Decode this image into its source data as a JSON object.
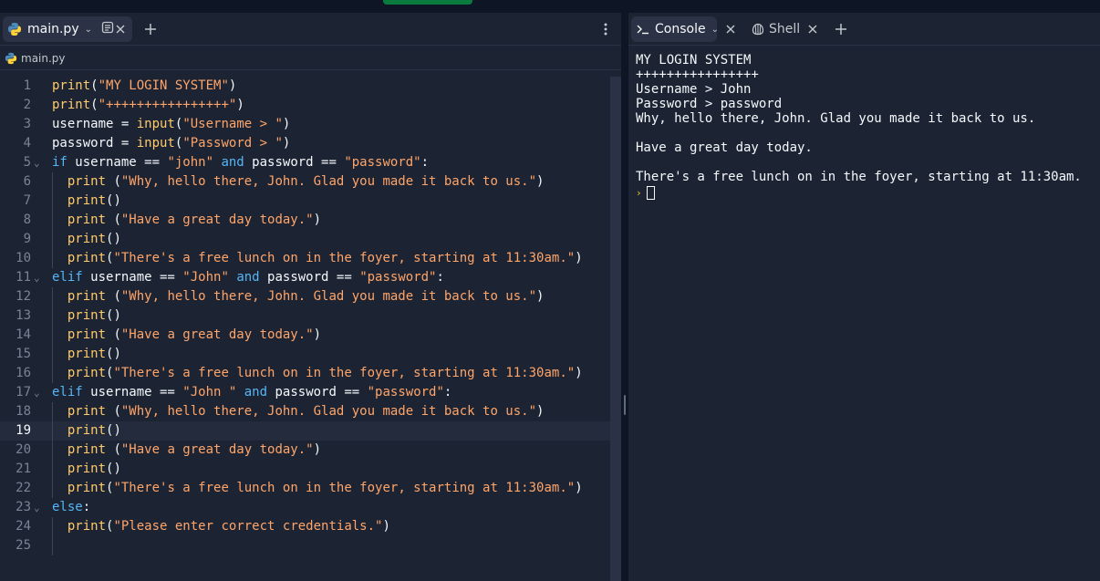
{
  "editor": {
    "tab_label": "main.py",
    "breadcrumb": "main.py",
    "current_line": 19,
    "lines": [
      {
        "n": "1",
        "fold": false,
        "tokens": [
          [
            "fn",
            "print"
          ],
          [
            "pl",
            "("
          ],
          [
            "st",
            "\"MY LOGIN SYSTEM\""
          ],
          [
            "pl",
            ")"
          ]
        ]
      },
      {
        "n": "2",
        "fold": false,
        "tokens": [
          [
            "fn",
            "print"
          ],
          [
            "pl",
            "("
          ],
          [
            "st",
            "\"++++++++++++++++\""
          ],
          [
            "pl",
            ")"
          ]
        ]
      },
      {
        "n": "3",
        "fold": false,
        "tokens": [
          [
            "pl",
            "username = "
          ],
          [
            "fn",
            "input"
          ],
          [
            "pl",
            "("
          ],
          [
            "st",
            "\"Username > \""
          ],
          [
            "pl",
            ")"
          ]
        ]
      },
      {
        "n": "4",
        "fold": false,
        "tokens": [
          [
            "pl",
            "password = "
          ],
          [
            "fn",
            "input"
          ],
          [
            "pl",
            "("
          ],
          [
            "st",
            "\"Password > \""
          ],
          [
            "pl",
            ")"
          ]
        ]
      },
      {
        "n": "5",
        "fold": true,
        "tokens": [
          [
            "kw",
            "if"
          ],
          [
            "pl",
            " username == "
          ],
          [
            "st",
            "\"john\""
          ],
          [
            "pl",
            " "
          ],
          [
            "kw",
            "and"
          ],
          [
            "pl",
            " password == "
          ],
          [
            "st",
            "\"password\""
          ],
          [
            "pl",
            ":"
          ]
        ]
      },
      {
        "n": "6",
        "fold": false,
        "tokens": [
          [
            "pl",
            "  "
          ],
          [
            "fn",
            "print"
          ],
          [
            "pl",
            " ("
          ],
          [
            "st",
            "\"Why, hello there, John. Glad you made it back to us.\""
          ],
          [
            "pl",
            ")"
          ]
        ]
      },
      {
        "n": "7",
        "fold": false,
        "tokens": [
          [
            "pl",
            "  "
          ],
          [
            "fn",
            "print"
          ],
          [
            "pl",
            "()"
          ]
        ]
      },
      {
        "n": "8",
        "fold": false,
        "tokens": [
          [
            "pl",
            "  "
          ],
          [
            "fn",
            "print"
          ],
          [
            "pl",
            " ("
          ],
          [
            "st",
            "\"Have a great day today.\""
          ],
          [
            "pl",
            ")"
          ]
        ]
      },
      {
        "n": "9",
        "fold": false,
        "tokens": [
          [
            "pl",
            "  "
          ],
          [
            "fn",
            "print"
          ],
          [
            "pl",
            "()"
          ]
        ]
      },
      {
        "n": "10",
        "fold": false,
        "tokens": [
          [
            "pl",
            "  "
          ],
          [
            "fn",
            "print"
          ],
          [
            "pl",
            "("
          ],
          [
            "st",
            "\"There's a free lunch on in the foyer, starting at 11:30am.\""
          ],
          [
            "pl",
            ")"
          ]
        ]
      },
      {
        "n": "11",
        "fold": true,
        "tokens": [
          [
            "kw",
            "elif"
          ],
          [
            "pl",
            " username == "
          ],
          [
            "st",
            "\"John\""
          ],
          [
            "pl",
            " "
          ],
          [
            "kw",
            "and"
          ],
          [
            "pl",
            " password == "
          ],
          [
            "st",
            "\"password\""
          ],
          [
            "pl",
            ":"
          ]
        ]
      },
      {
        "n": "12",
        "fold": false,
        "tokens": [
          [
            "pl",
            "  "
          ],
          [
            "fn",
            "print"
          ],
          [
            "pl",
            " ("
          ],
          [
            "st",
            "\"Why, hello there, John. Glad you made it back to us.\""
          ],
          [
            "pl",
            ")"
          ]
        ]
      },
      {
        "n": "13",
        "fold": false,
        "tokens": [
          [
            "pl",
            "  "
          ],
          [
            "fn",
            "print"
          ],
          [
            "pl",
            "()"
          ]
        ]
      },
      {
        "n": "14",
        "fold": false,
        "tokens": [
          [
            "pl",
            "  "
          ],
          [
            "fn",
            "print"
          ],
          [
            "pl",
            " ("
          ],
          [
            "st",
            "\"Have a great day today.\""
          ],
          [
            "pl",
            ")"
          ]
        ]
      },
      {
        "n": "15",
        "fold": false,
        "tokens": [
          [
            "pl",
            "  "
          ],
          [
            "fn",
            "print"
          ],
          [
            "pl",
            "()"
          ]
        ]
      },
      {
        "n": "16",
        "fold": false,
        "tokens": [
          [
            "pl",
            "  "
          ],
          [
            "fn",
            "print"
          ],
          [
            "pl",
            "("
          ],
          [
            "st",
            "\"There's a free lunch on in the foyer, starting at 11:30am.\""
          ],
          [
            "pl",
            ")"
          ]
        ]
      },
      {
        "n": "17",
        "fold": true,
        "tokens": [
          [
            "kw",
            "elif"
          ],
          [
            "pl",
            " username == "
          ],
          [
            "st",
            "\"John \""
          ],
          [
            "pl",
            " "
          ],
          [
            "kw",
            "and"
          ],
          [
            "pl",
            " password == "
          ],
          [
            "st",
            "\"password\""
          ],
          [
            "pl",
            ":"
          ]
        ]
      },
      {
        "n": "18",
        "fold": false,
        "tokens": [
          [
            "pl",
            "  "
          ],
          [
            "fn",
            "print"
          ],
          [
            "pl",
            " ("
          ],
          [
            "st",
            "\"Why, hello there, John. Glad you made it back to us.\""
          ],
          [
            "pl",
            ")"
          ]
        ]
      },
      {
        "n": "19",
        "fold": false,
        "tokens": [
          [
            "pl",
            "  "
          ],
          [
            "fn",
            "print"
          ],
          [
            "pl",
            "()"
          ]
        ]
      },
      {
        "n": "20",
        "fold": false,
        "tokens": [
          [
            "pl",
            "  "
          ],
          [
            "fn",
            "print"
          ],
          [
            "pl",
            " ("
          ],
          [
            "st",
            "\"Have a great day today.\""
          ],
          [
            "pl",
            ")"
          ]
        ]
      },
      {
        "n": "21",
        "fold": false,
        "tokens": [
          [
            "pl",
            "  "
          ],
          [
            "fn",
            "print"
          ],
          [
            "pl",
            "()"
          ]
        ]
      },
      {
        "n": "22",
        "fold": false,
        "tokens": [
          [
            "pl",
            "  "
          ],
          [
            "fn",
            "print"
          ],
          [
            "pl",
            "("
          ],
          [
            "st",
            "\"There's a free lunch on in the foyer, starting at 11:30am.\""
          ],
          [
            "pl",
            ")"
          ]
        ]
      },
      {
        "n": "23",
        "fold": true,
        "tokens": [
          [
            "kw",
            "else"
          ],
          [
            "pl",
            ":"
          ]
        ]
      },
      {
        "n": "24",
        "fold": false,
        "tokens": [
          [
            "pl",
            "  "
          ],
          [
            "fn",
            "print"
          ],
          [
            "pl",
            "("
          ],
          [
            "st",
            "\"Please enter correct credentials.\""
          ],
          [
            "pl",
            ")"
          ]
        ]
      },
      {
        "n": "25",
        "fold": false,
        "tokens": []
      }
    ]
  },
  "console": {
    "tab_console": "Console",
    "tab_shell": "Shell",
    "output": [
      "MY LOGIN SYSTEM",
      "++++++++++++++++",
      "Username > John",
      "Password > password",
      "Why, hello there, John. Glad you made it back to us.",
      "",
      "Have a great day today.",
      "",
      "There's a free lunch on in the foyer, starting at 11:30am."
    ]
  },
  "colors": {
    "keyword": "#56b6f5",
    "function": "#ffcb6b",
    "string": "#ffa569",
    "background": "#1c2333"
  }
}
